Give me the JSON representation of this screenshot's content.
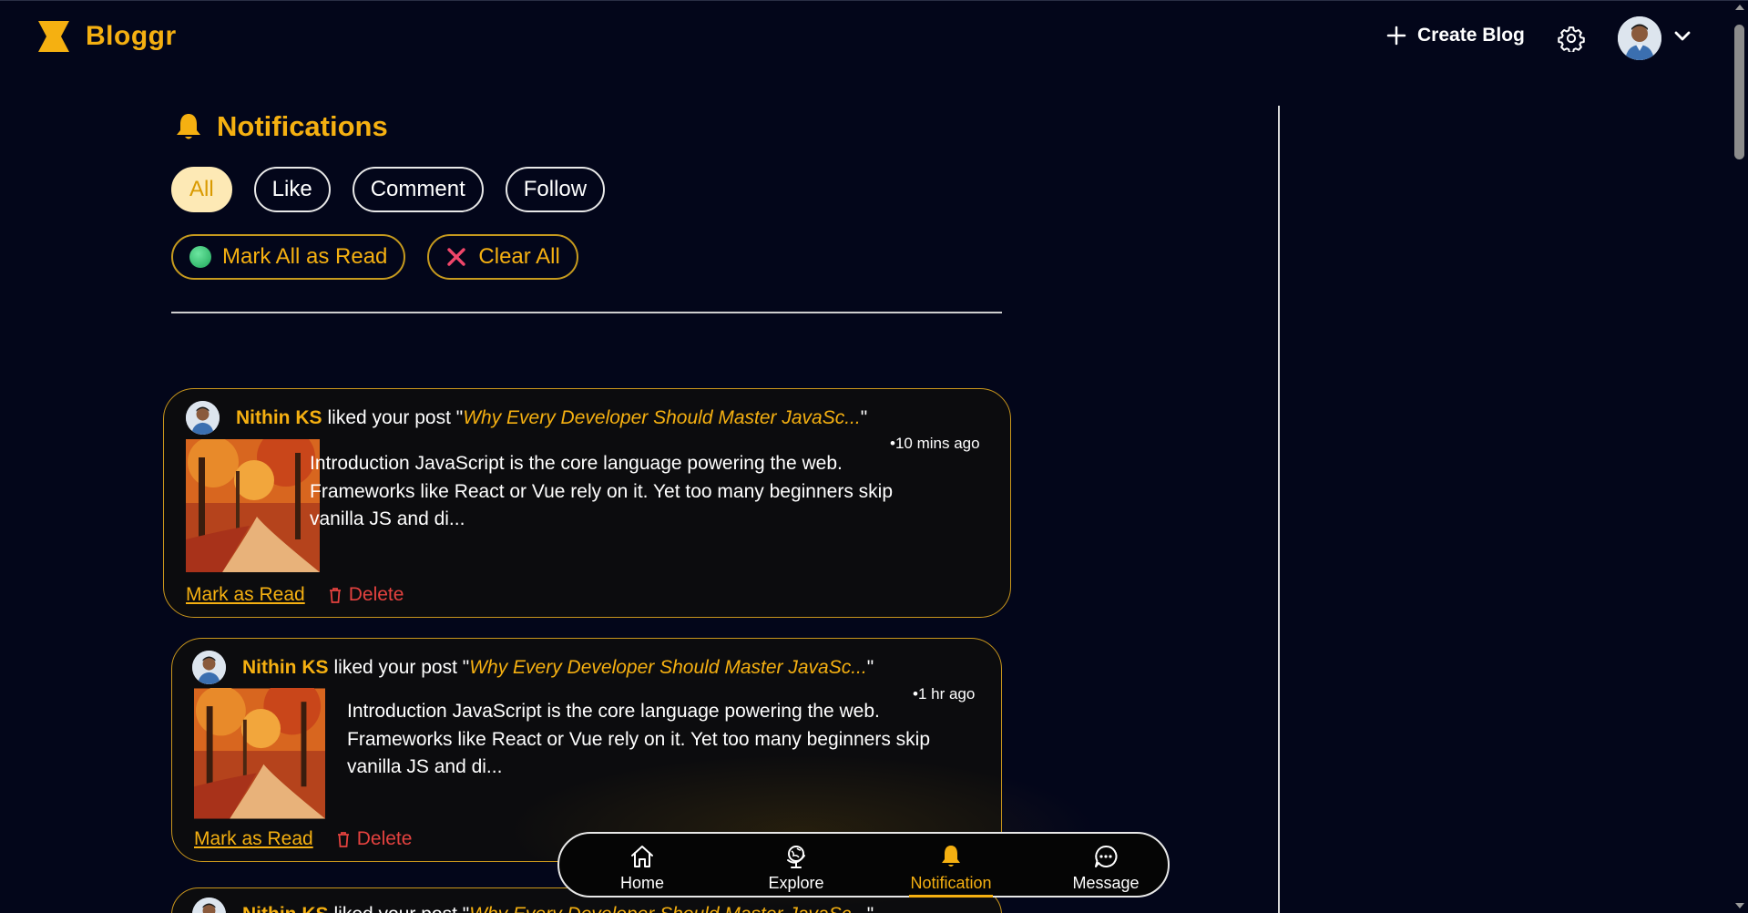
{
  "brand": {
    "name": "Bloggr"
  },
  "header": {
    "create_blog_label": "Create Blog"
  },
  "notifications": {
    "title": "Notifications",
    "filters": [
      "All",
      "Like",
      "Comment",
      "Follow"
    ],
    "active_filter": "All",
    "mark_all_label": "Mark All as Read",
    "clear_all_label": "Clear All"
  },
  "cards": [
    {
      "user": "Nithin KS",
      "action": "liked your post \"",
      "post_title": "Why Every Developer Should Master JavaSc...",
      "close_quote": "\"",
      "time": "•10 mins ago",
      "excerpt": "Introduction JavaScript is the core language powering the web. Frameworks like React or Vue rely on it. Yet too many beginners skip vanilla JS and di...",
      "mark_read_label": "Mark as Read",
      "delete_label": "Delete"
    },
    {
      "user": "Nithin KS",
      "action": "liked your post \"",
      "post_title": "Why Every Developer Should Master JavaSc...",
      "close_quote": "\"",
      "time": "•1 hr ago",
      "excerpt": "Introduction JavaScript is the core language powering the web. Frameworks like React or Vue rely on it. Yet too many beginners skip vanilla JS and di...",
      "mark_read_label": "Mark as Read",
      "delete_label": "Delete"
    },
    {
      "user": "Nithin KS",
      "action": "liked your post \"",
      "post_title": "Why Every Developer Should Master JavaSc...",
      "close_quote": "\""
    }
  ],
  "bottom_nav": {
    "items": [
      "Home",
      "Explore",
      "Notification",
      "Message"
    ],
    "active": "Notification"
  },
  "colors": {
    "accent": "#f5b011",
    "background": "#03061a",
    "danger": "#e4423f",
    "chip_active_bg": "#fde9b5"
  },
  "icons": {
    "logo": "hourglass-logo-icon",
    "create": "plus-icon",
    "settings": "gear-icon",
    "profile": "avatar",
    "menu": "chevron-down-icon",
    "title": "bell-icon",
    "mark_all": "green-dot-icon",
    "clear_all": "x-icon",
    "delete": "trash-icon",
    "nav": [
      "home-icon",
      "globe-icon",
      "bell-icon",
      "chat-icon"
    ]
  }
}
